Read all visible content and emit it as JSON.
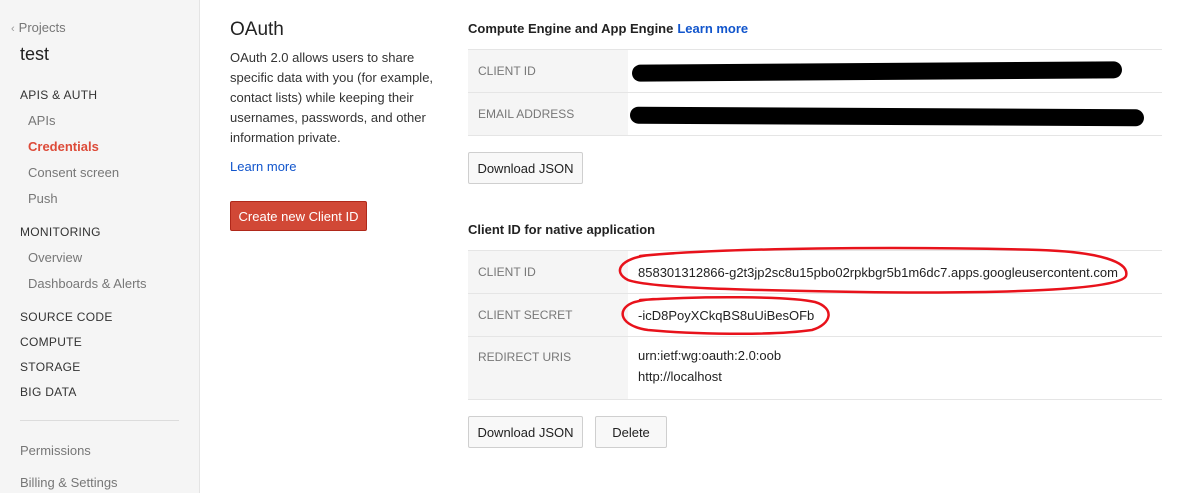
{
  "sidebar": {
    "back_label": "Projects",
    "project_name": "test",
    "sections": [
      {
        "label": "APIS & AUTH"
      },
      {
        "label": "MONITORING"
      },
      {
        "label": "SOURCE CODE"
      },
      {
        "label": "COMPUTE"
      },
      {
        "label": "STORAGE"
      },
      {
        "label": "BIG DATA"
      }
    ],
    "apis_auth_items": [
      {
        "label": "APIs"
      },
      {
        "label": "Credentials",
        "active": true
      },
      {
        "label": "Consent screen"
      },
      {
        "label": "Push"
      }
    ],
    "monitoring_items": [
      {
        "label": "Overview"
      },
      {
        "label": "Dashboards & Alerts"
      }
    ],
    "footer_items": [
      {
        "label": "Permissions"
      },
      {
        "label": "Billing & Settings"
      }
    ]
  },
  "oauth": {
    "title": "OAuth",
    "description": "OAuth 2.0 allows users to share specific data with you (for example, contact lists) while keeping their usernames, passwords, and other information private.",
    "learn_more": "Learn more",
    "create_button": "Create new Client ID"
  },
  "compute_section": {
    "title": "Compute Engine and App Engine",
    "learn_more": "Learn more",
    "client_id_label": "CLIENT ID",
    "email_label": "EMAIL ADDRESS",
    "download_button": "Download JSON"
  },
  "native_section": {
    "title": "Client ID for native application",
    "client_id_label": "CLIENT ID",
    "client_id_value": "858301312866-g2t3jp2sc8u15pbo02rpkbgr5b1m6dc7.apps.googleusercontent.com",
    "client_secret_label": "CLIENT SECRET",
    "client_secret_value": "-icD8PoyXCkqBS8uUiBesOFb",
    "redirect_label": "REDIRECT URIS",
    "redirect_uris": [
      "urn:ietf:wg:oauth:2.0:oob",
      "http://localhost"
    ],
    "download_button": "Download JSON",
    "delete_button": "Delete"
  },
  "colors": {
    "accent_red": "#dd4b39",
    "link_blue": "#1155cc",
    "annotation_red": "#e8121b"
  }
}
